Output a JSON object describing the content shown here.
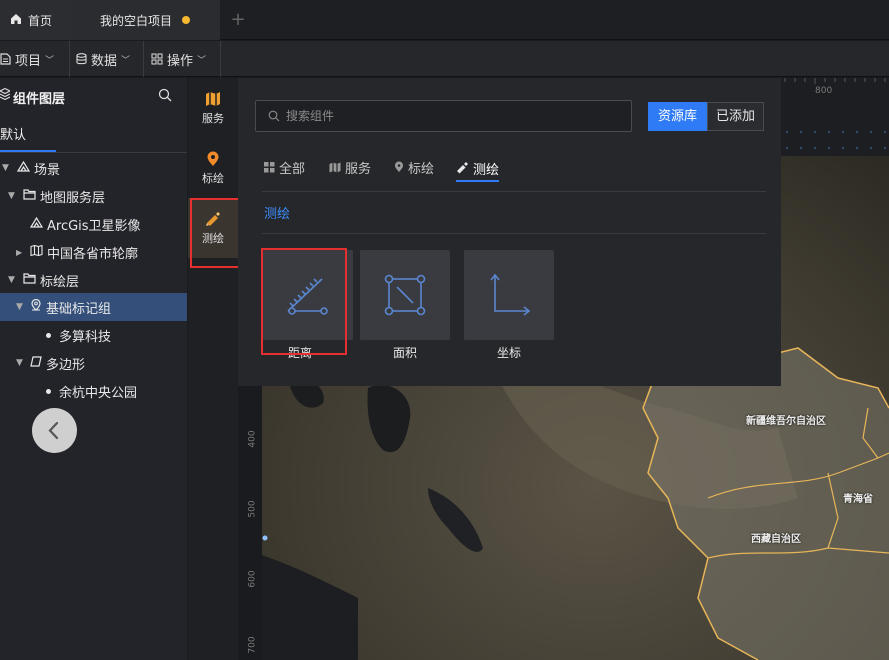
{
  "tabs": {
    "home": "首页",
    "project": "我的空白项目",
    "add": "+"
  },
  "menu": {
    "project": "项目",
    "data": "数据",
    "operate": "操作"
  },
  "layers": {
    "title": "组件图层",
    "tab_default": "默认",
    "items": [
      {
        "label": "场景"
      },
      {
        "label": "地图服务层"
      },
      {
        "label": "ArcGis卫星影像"
      },
      {
        "label": "中国各省市轮廓"
      },
      {
        "label": "标绘层"
      },
      {
        "label": "基础标记组"
      },
      {
        "label": "多算科技"
      },
      {
        "label": "多边形"
      },
      {
        "label": "余杭中央公园"
      }
    ]
  },
  "rail": {
    "service": "服务",
    "marker": "标绘",
    "survey": "测绘"
  },
  "popup": {
    "search_placeholder": "搜索组件",
    "btn_library": "资源库",
    "btn_added": "已添加",
    "categories": {
      "all": "全部",
      "service": "服务",
      "marker": "标绘",
      "survey": "测绘"
    },
    "group_label": "测绘",
    "cards": {
      "distance": "距离",
      "area": "面积",
      "coordinate": "坐标"
    }
  },
  "map": {
    "labels": {
      "xinjiang": "新疆维吾尔自治区",
      "qinghai": "青海省",
      "tibet": "西藏自治区"
    },
    "ruler": {
      "top": "800",
      "left": [
        "400",
        "500",
        "600",
        "700"
      ]
    }
  },
  "colors": {
    "accent": "#2f7bf5",
    "highlight": "#e62f2f",
    "unsaved": "#f5b82e",
    "marker_icon": "#f08a2a",
    "survey_icon": "#e8962e"
  }
}
